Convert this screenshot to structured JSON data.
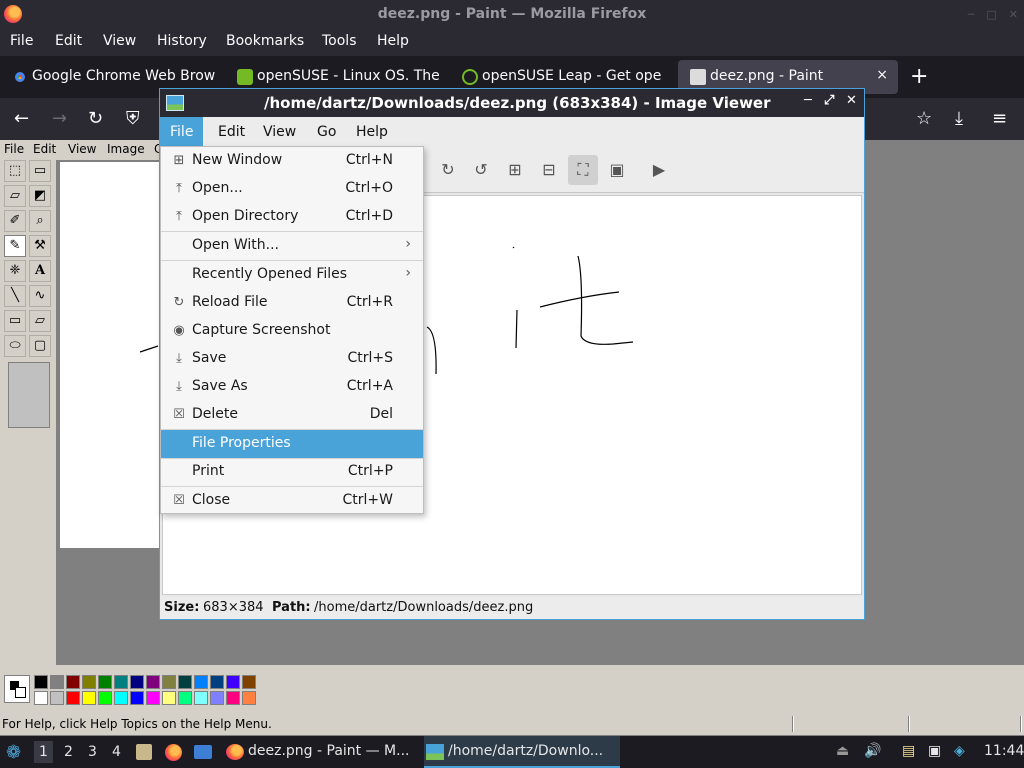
{
  "firefox": {
    "window_title": "deez.png - Paint — Mozilla Firefox",
    "menu": [
      "File",
      "Edit",
      "View",
      "History",
      "Bookmarks",
      "Tools",
      "Help"
    ],
    "tabs": [
      {
        "label": "Google Chrome Web Brow",
        "icon": "chrome-icon"
      },
      {
        "label": "openSUSE - Linux OS. The",
        "icon": "opensuse-icon"
      },
      {
        "label": "openSUSE Leap - Get ope",
        "icon": "opensuse-leap-icon"
      },
      {
        "label": "deez.png - Paint",
        "icon": "paint-icon",
        "active": true,
        "close": "×"
      }
    ],
    "new_tab": "+",
    "nav_icons": [
      "back-icon",
      "forward-icon",
      "reload-icon",
      "shield-icon",
      "star-icon",
      "download-icon",
      "menu-icon"
    ]
  },
  "paint": {
    "menu": [
      "File",
      "Edit",
      "View",
      "Image",
      "C"
    ],
    "status_text": "For Help, click Help Topics on the Help Menu.",
    "palette_top": [
      "#000000",
      "#808080",
      "#800000",
      "#808000",
      "#008000",
      "#008080",
      "#000080",
      "#800080",
      "#808040",
      "#004040",
      "#0080ff",
      "#004080",
      "#4000ff",
      "#804000"
    ],
    "palette_bottom": [
      "#ffffff",
      "#c0c0c0",
      "#ff0000",
      "#ffff00",
      "#00ff00",
      "#00ffff",
      "#0000ff",
      "#ff00ff",
      "#ffff80",
      "#00ff80",
      "#80ffff",
      "#8080ff",
      "#ff0080",
      "#ff8040"
    ]
  },
  "viewer": {
    "title": "/home/dartz/Downloads/deez.png (683x384) - Image Viewer",
    "menu": [
      "File",
      "Edit",
      "View",
      "Go",
      "Help"
    ],
    "status_size_label": "Size:",
    "status_size": "683×384",
    "status_path_label": "Path:",
    "status_path": "/home/dartz/Downloads/deez.png",
    "file_menu": [
      {
        "label": "New Window",
        "shortcut": "Ctrl+N",
        "icon": "new-window-icon"
      },
      {
        "label": "Open...",
        "shortcut": "Ctrl+O",
        "icon": "open-icon"
      },
      {
        "label": "Open Directory",
        "shortcut": "Ctrl+D",
        "icon": "open-directory-icon"
      },
      {
        "label": "Open With...",
        "shortcut": "",
        "icon": "",
        "submenu": true
      },
      {
        "label": "Recently Opened Files",
        "shortcut": "",
        "icon": "",
        "submenu": true
      },
      {
        "label": "Reload File",
        "shortcut": "Ctrl+R",
        "icon": "reload-icon"
      },
      {
        "label": "Capture Screenshot",
        "shortcut": "",
        "icon": "camera-icon"
      },
      {
        "label": "Save",
        "shortcut": "Ctrl+S",
        "icon": "save-icon"
      },
      {
        "label": "Save As",
        "shortcut": "Ctrl+A",
        "icon": "save-as-icon"
      },
      {
        "label": "Delete",
        "shortcut": "Del",
        "icon": "delete-icon"
      },
      {
        "label": "File Properties",
        "shortcut": "",
        "icon": "",
        "highlighted": true
      },
      {
        "label": "Print",
        "shortcut": "Ctrl+P",
        "icon": ""
      },
      {
        "label": "Close",
        "shortcut": "Ctrl+W",
        "icon": "close-icon"
      }
    ]
  },
  "taskbar": {
    "workspaces": [
      "1",
      "2",
      "3",
      "4"
    ],
    "current_workspace": "1",
    "tasks": [
      {
        "label": "deez.png - Paint — M...",
        "icon": "firefox-icon"
      },
      {
        "label": "/home/dartz/Downlo...",
        "icon": "image-viewer-icon",
        "active": true
      }
    ],
    "clock": "11:44"
  }
}
